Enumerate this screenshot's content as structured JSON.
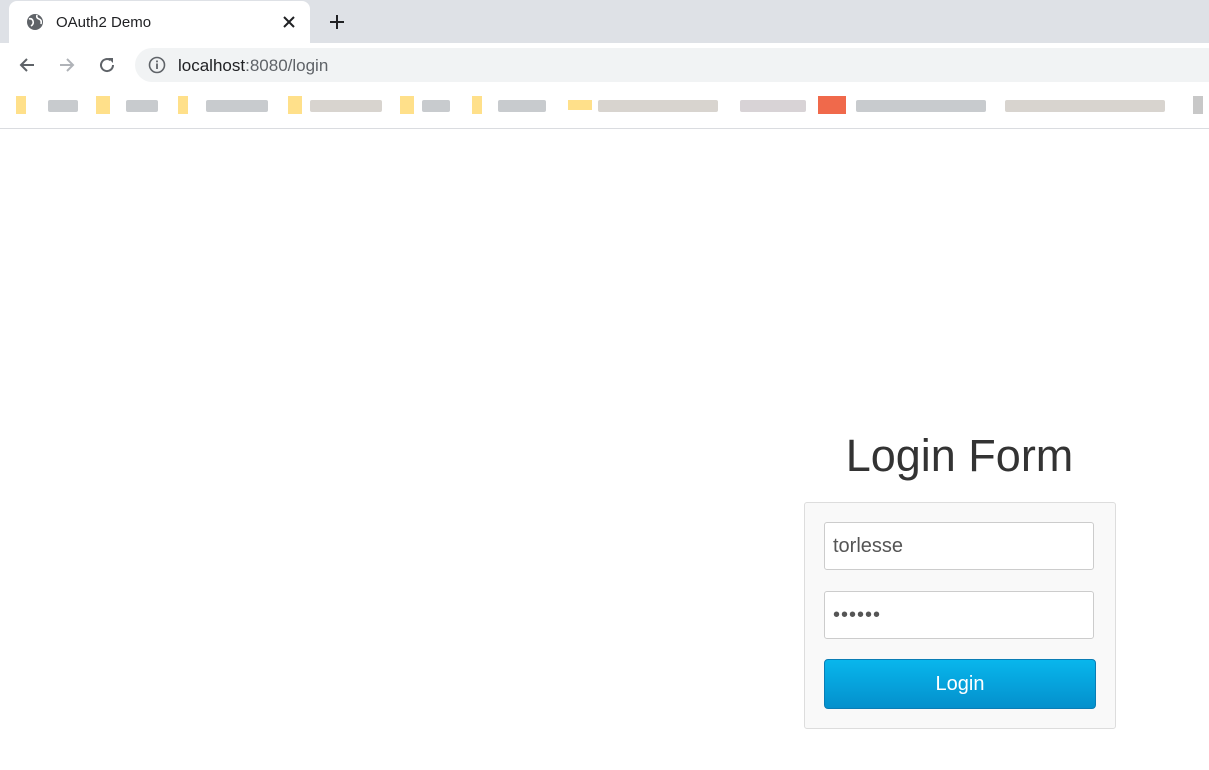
{
  "browser": {
    "tab": {
      "title": "OAuth2 Demo",
      "icon": "globe-icon",
      "close_icon": "close-icon"
    },
    "new_tab_icon": "plus-icon",
    "nav": {
      "back_icon": "back-arrow-icon",
      "forward_icon": "forward-arrow-icon",
      "reload_icon": "reload-icon"
    },
    "address": {
      "host": "localhost",
      "rest": ":8080/login",
      "icon": "info-icon"
    }
  },
  "page": {
    "title": "Login Form",
    "username_value": "torlesse",
    "password_value": "••••••",
    "login_button": "Login"
  },
  "colors": {
    "tabstrip": "#dee1e6",
    "button_top": "#08b6ec",
    "button_bottom": "#0490cc",
    "panel_bg": "#f9f9f9"
  }
}
